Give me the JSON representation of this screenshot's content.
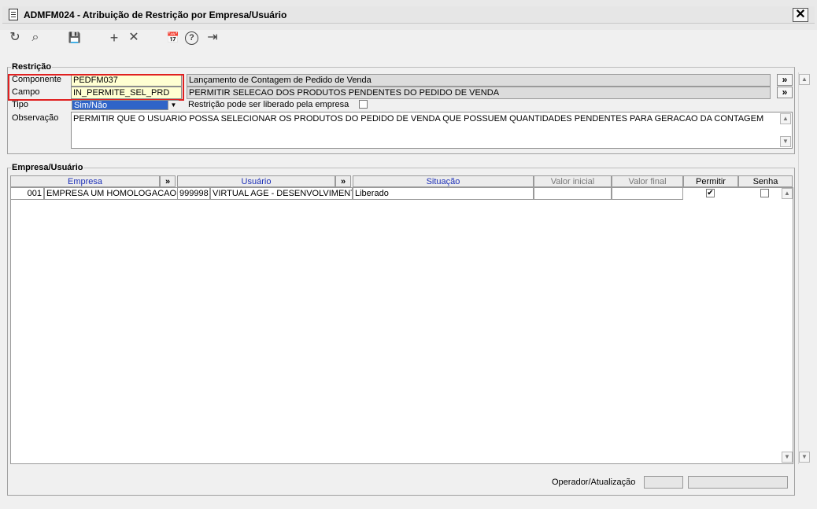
{
  "window": {
    "title": "ADMFM024 - Atribuição de Restrição por Empresa/Usuário",
    "close_label": "✕"
  },
  "toolbar": {
    "refresh_glyph": "↻",
    "search_glyph": "⌕",
    "save_glyph": "💾",
    "add_glyph": "+",
    "delete_glyph": "✕",
    "calendar_glyph": "📅",
    "help_glyph": "?",
    "exit_glyph": "⇥"
  },
  "restricao": {
    "group_title": "Restrição",
    "componente_label": "Componente",
    "componente_value": "PEDFM037",
    "componente_desc": "Lançamento de Contagem de Pedido de Venda",
    "campo_label": "Campo",
    "campo_value": "IN_PERMITE_SEL_PRD",
    "campo_desc": "PERMITIR SELECAO DOS PRODUTOS PENDENTES DO PEDIDO DE VENDA",
    "tipo_label": "Tipo",
    "tipo_value": "Sim/Não",
    "liberado_label": "Restrição pode ser liberado pela empresa",
    "observacao_label": "Observação",
    "observacao_value": "PERMITIR QUE O USUARIO POSSA SELECIONAR OS PRODUTOS DO PEDIDO DE VENDA QUE POSSUEM QUANTIDADES PENDENTES PARA GERACAO DA CONTAGEM",
    "lookup_glyph": "»"
  },
  "empresa_usuario": {
    "group_title": "Empresa/Usuário",
    "headers": {
      "empresa": "Empresa",
      "usuario": "Usuário",
      "situacao": "Situação",
      "valor_inicial": "Valor inicial",
      "valor_final": "Valor final",
      "permitir": "Permitir",
      "senha": "Senha",
      "lookup": "»"
    },
    "rows": [
      {
        "empresa_code": "001",
        "empresa_name": "EMPRESA UM HOMOLOGACAO",
        "usuario_code": "999998",
        "usuario_name": "VIRTUAL AGE - DESENVOLVIMENTO",
        "situacao": "Liberado",
        "valor_inicial": "",
        "valor_final": "",
        "permitir_check": "✔",
        "senha_check": ""
      }
    ]
  },
  "status": {
    "operador_label": "Operador/Atualização"
  },
  "scroll": {
    "up": "▲",
    "down": "▼"
  }
}
